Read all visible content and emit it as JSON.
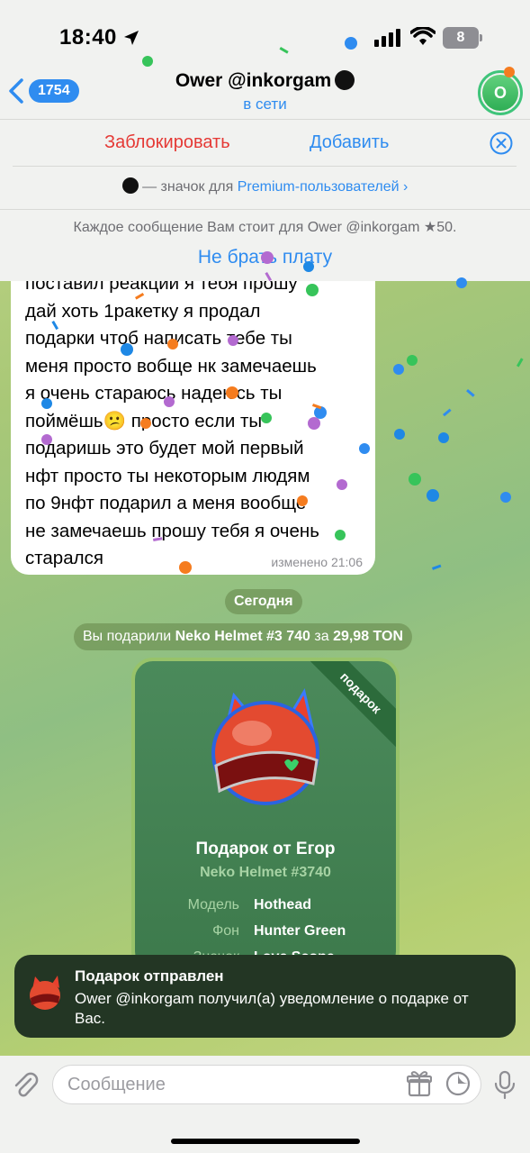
{
  "status_bar": {
    "time": "18:40",
    "battery": "8"
  },
  "header": {
    "back_count": "1754",
    "title": "Ower @inkorgam",
    "subtitle": "в сети",
    "avatar_letter": "O"
  },
  "actions": {
    "block": "Заблокировать",
    "add": "Добавить"
  },
  "premium_notice": {
    "prefix": "— значок для ",
    "link": "Premium-пользователей",
    "chevron": "›"
  },
  "paid_messages": {
    "text": "Каждое сообщение Вам стоит для Ower @inkorgam",
    "star": "★",
    "price": "50.",
    "button": "Не брать плату"
  },
  "message": {
    "text": "поставил реакции я тебя прошу\nдай хоть 1ракетку я продал\nподарки чтоб написать тебе ты\nменя просто вобще нк замечаешь\nя очень стараюсь надеюсь ты\nпоймёшь😕 просто если ты\nподаришь это будет мой первый\nнфт просто ты некоторым людям\nпо 9нфт подарил а меня вообще\nне замечаешь прошу тебя я очень\nстарался",
    "meta": "изменено 21:06"
  },
  "date_chip": "Сегодня",
  "service": {
    "prefix": "Вы подарили ",
    "gift": "Neko Helmet #3 740",
    "mid": " за ",
    "price": "29,98 TON"
  },
  "gift_card": {
    "ribbon": "подарок",
    "title": "Подарок от Егор",
    "subtitle": "Neko Helmet #3740",
    "attributes": [
      {
        "label": "Модель",
        "value": "Hothead"
      },
      {
        "label": "Фон",
        "value": "Hunter Green"
      },
      {
        "label": "Значок",
        "value": "Love Scope"
      }
    ]
  },
  "toast": {
    "title": "Подарок отправлен",
    "body": "Ower @inkorgam получил(а) уведомление о подарке от Вас."
  },
  "composer": {
    "placeholder": "Сообщение"
  },
  "colors": {
    "accent": "#2f8cf0",
    "danger": "#e53935",
    "gift_bg": "#3d7a4c"
  }
}
